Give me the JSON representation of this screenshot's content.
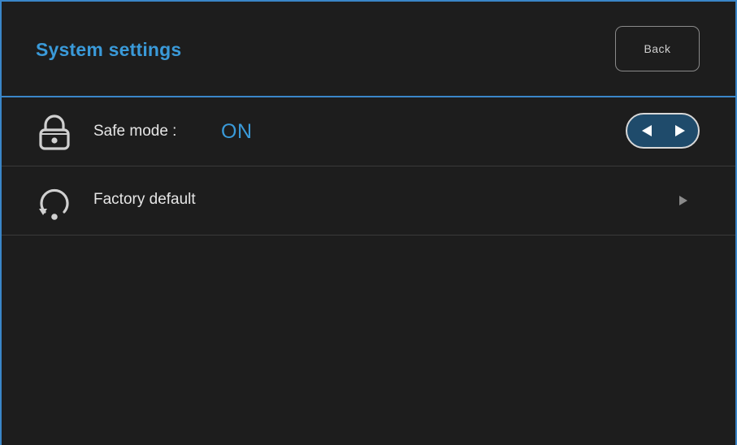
{
  "header": {
    "title": "System settings",
    "back_label": "Back"
  },
  "rows": [
    {
      "label": "Safe mode :",
      "value": "ON",
      "icon": "lock-icon"
    },
    {
      "label": "Factory default",
      "icon": "reset-icon"
    }
  ],
  "colors": {
    "accent": "#3a9ad9",
    "border": "#3a86c8",
    "background": "#1d1d1d",
    "toggle_bg": "#1f4b6b"
  }
}
